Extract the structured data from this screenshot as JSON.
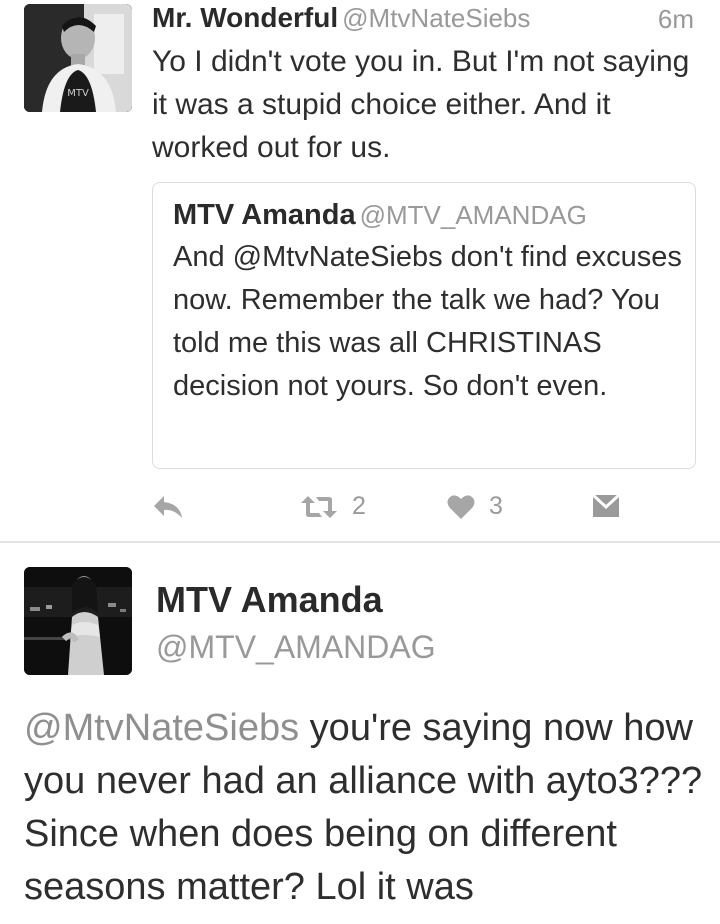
{
  "tweet1": {
    "name": "Mr. Wonderful",
    "handle": "@MtvNateSiebs",
    "time": "6m",
    "text": "Yo I didn't vote you in. But I'm not saying it was a stupid choice either. And it worked out for us.",
    "quoted": {
      "name": "MTV Amanda",
      "handle": "@MTV_AMANDAG",
      "text": "And @MtvNateSiebs don't find excuses now. Remember the talk we had? You told me this was all CHRISTINAS decision not yours. So don't even."
    },
    "actions": {
      "reply_icon": "reply-icon",
      "retweet_icon": "retweet-icon",
      "retweet_count": "2",
      "like_icon": "heart-icon",
      "like_count": "3",
      "dm_icon": "envelope-icon"
    }
  },
  "tweet2": {
    "name": "MTV Amanda",
    "handle": "@MTV_AMANDAG",
    "mention": "@MtvNateSiebs",
    "text": " you're saying now how you never had an alliance with ayto3??? Since when does being on different seasons matter? Lol it was"
  },
  "colors": {
    "text": "#2e2e2e",
    "muted": "#999999",
    "border": "#dcdcdc",
    "background": "#ffffff"
  }
}
